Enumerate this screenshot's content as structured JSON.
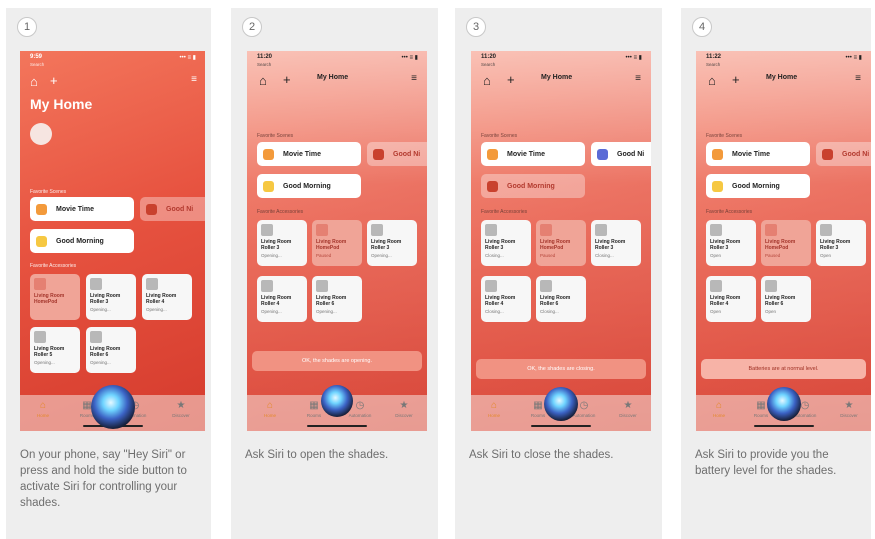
{
  "cards": [
    {
      "step": "1",
      "caption": "On your phone, say \"Hey Siri\" or press and hold the side button to activate Siri for controlling your shades.",
      "status_time": "9:59",
      "status_sub": "Search",
      "home_title": "My Home",
      "favorite_scenes_label": "Favorite Scenes",
      "favorite_accessories_label": "Favorite Accessories",
      "scenes": [
        "Movie Time",
        "Good Ni",
        "Good Morning"
      ],
      "tiles": [
        {
          "name": "Living Room HomePod",
          "state": ""
        },
        {
          "name": "Living Room Roller 3",
          "state": "Opening..."
        },
        {
          "name": "Living Room Roller 4",
          "state": "Opening..."
        },
        {
          "name": "Living Room Roller 5",
          "state": "Opening..."
        },
        {
          "name": "Living Room Roller 6",
          "state": "Opening..."
        }
      ],
      "tabs": [
        "Home",
        "Rooms",
        "Automation",
        "Discover"
      ]
    },
    {
      "step": "2",
      "caption": "Ask Siri to open the shades.",
      "status_time": "11:20",
      "status_sub": "Search",
      "home_title": "My Home",
      "favorite_scenes_label": "Favorite Scenes",
      "favorite_accessories_label": "Favorite Accessories",
      "scenes": [
        "Movie Time",
        "Good Ni",
        "Good Morning"
      ],
      "tiles": [
        {
          "name": "Living Room Roller 3",
          "state": "Opening..."
        },
        {
          "name": "Living Room HomePod",
          "state": "Paused"
        },
        {
          "name": "Living Room Roller 3",
          "state": "Opening..."
        },
        {
          "name": "Living Room Roller 4",
          "state": "Opening..."
        },
        {
          "name": "Living Room Roller 6",
          "state": "Opening..."
        }
      ],
      "siri_response": "OK, the shades are opening.",
      "tabs": [
        "Home",
        "Rooms",
        "Automation",
        "Discover"
      ]
    },
    {
      "step": "3",
      "caption": "Ask Siri to close the shades.",
      "status_time": "11:20",
      "status_sub": "Search",
      "home_title": "My Home",
      "favorite_scenes_label": "Favorite Scenes",
      "favorite_accessories_label": "Favorite Accessories",
      "scenes": [
        "Movie Time",
        "Good Ni",
        "Good Morning"
      ],
      "tiles": [
        {
          "name": "Living Room Roller 3",
          "state": "Closing..."
        },
        {
          "name": "Living Room HomePod",
          "state": "Paused"
        },
        {
          "name": "Living Room Roller 3",
          "state": "Closing..."
        },
        {
          "name": "Living Room Roller 4",
          "state": "Closing..."
        },
        {
          "name": "Living Room Roller 6",
          "state": "Closing..."
        }
      ],
      "siri_response": "OK, the shades are closing.",
      "tabs": [
        "Home",
        "Rooms",
        "Automation",
        "Discover"
      ]
    },
    {
      "step": "4",
      "caption": "Ask Siri to provide you the battery level for the shades.",
      "status_time": "11:22",
      "status_sub": "Search",
      "home_title": "My Home",
      "favorite_scenes_label": "Favorite Scenes",
      "favorite_accessories_label": "Favorite Accessories",
      "scenes": [
        "Movie Time",
        "Good Ni",
        "Good Morning"
      ],
      "tiles": [
        {
          "name": "Living Room Roller 3",
          "state": "Open"
        },
        {
          "name": "Living Room HomePod",
          "state": "Paused"
        },
        {
          "name": "Living Room Roller 3",
          "state": "Open"
        },
        {
          "name": "Living Room Roller 4",
          "state": "Open"
        },
        {
          "name": "Living Room Roller 6",
          "state": "Open"
        }
      ],
      "siri_response": "Batteries are at normal level.",
      "tabs": [
        "Home",
        "Rooms",
        "Automation",
        "Discover"
      ]
    }
  ],
  "status_icons": "••• ≡ ▮",
  "icons": {
    "home": "house-icon",
    "add": "plus-icon",
    "settings": "gear-icon",
    "siri": "siri-orb",
    "tab_home": "house-icon",
    "tab_rooms": "rooms-icon",
    "tab_automation": "clock-icon",
    "tab_discover": "star-icon"
  },
  "colors": {
    "app_background": "#e75340",
    "active_tab": "#e4892a",
    "caption_text": "#6e6e6e",
    "siri_response_bubble": "#f19282"
  }
}
